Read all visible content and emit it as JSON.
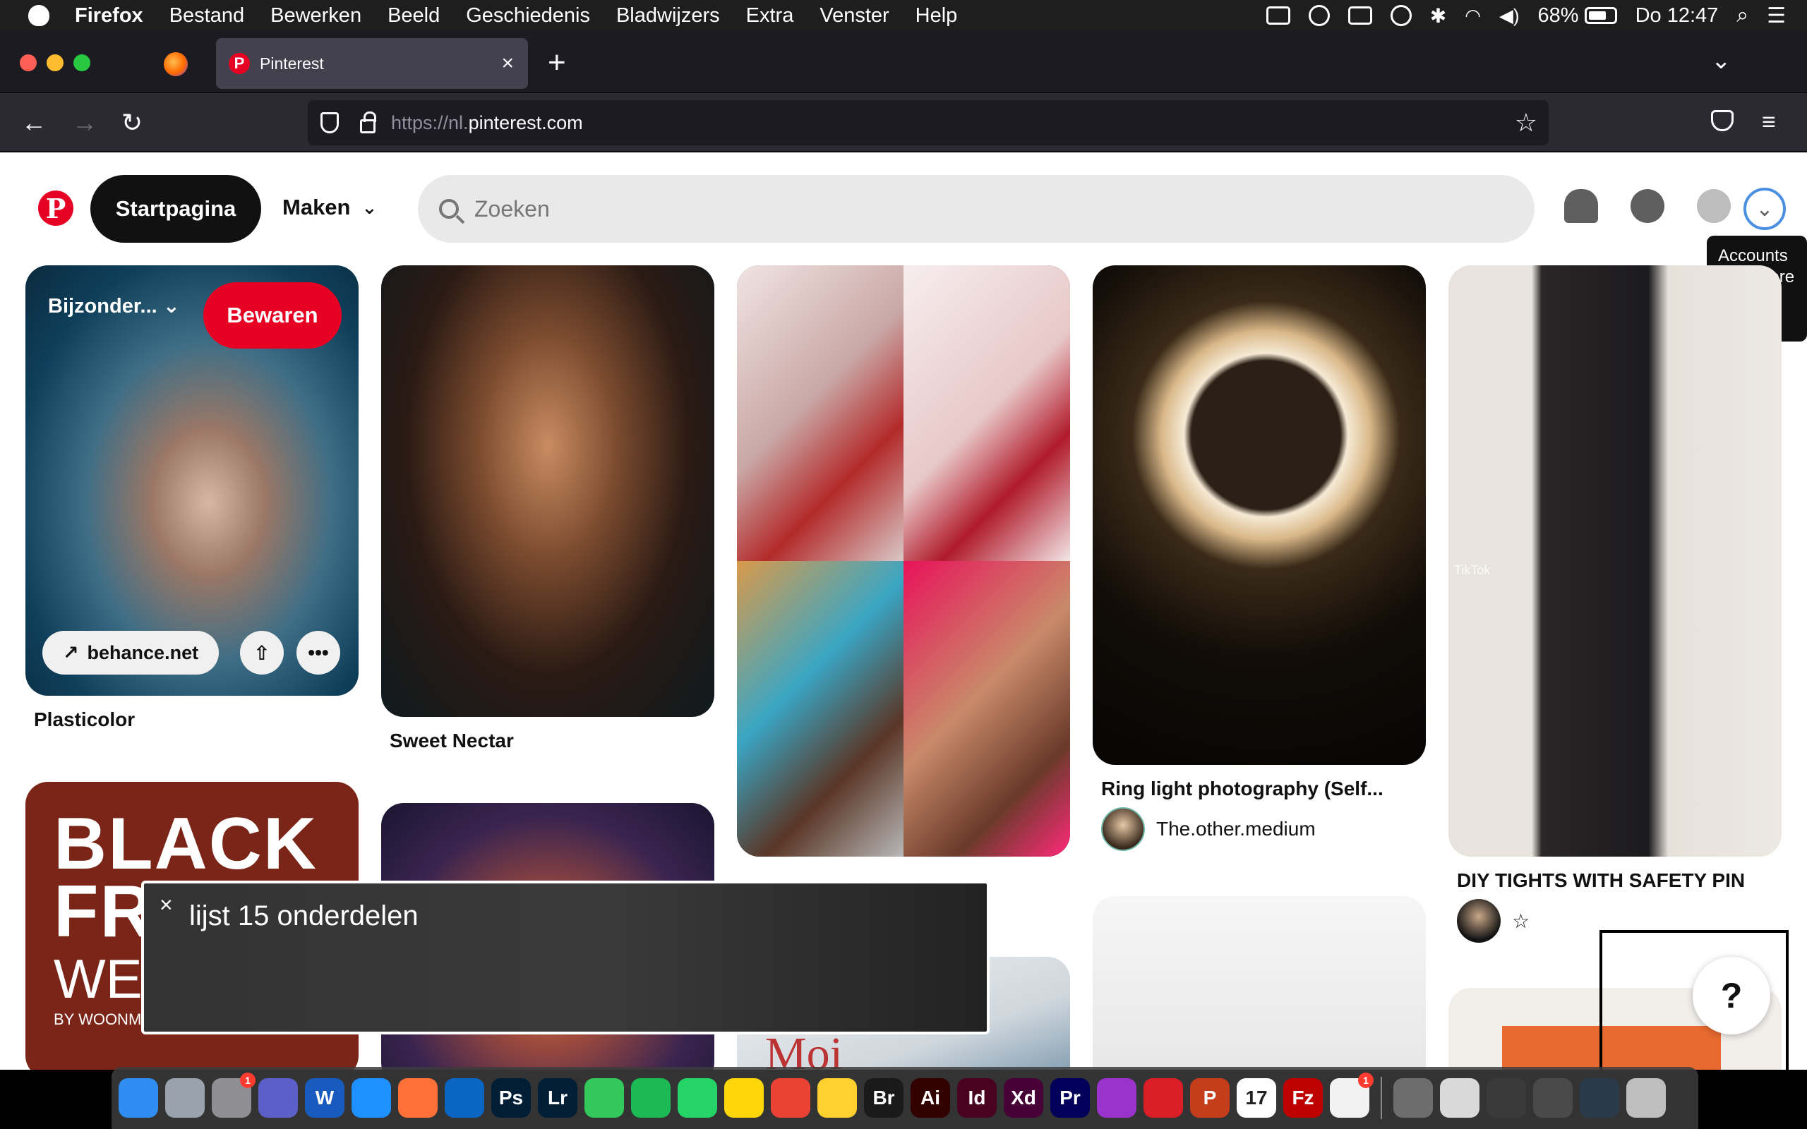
{
  "menubar": {
    "app_name": "Firefox",
    "items": [
      "Bestand",
      "Bewerken",
      "Beeld",
      "Geschiedenis",
      "Bladwijzers",
      "Extra",
      "Venster",
      "Help"
    ],
    "battery": "68%",
    "clock": "Do 12:47"
  },
  "browser": {
    "tab_title": "Pinterest",
    "tab_favicon": "P",
    "url_prefix": "https://nl.",
    "url_domain": "pinterest.com"
  },
  "pinterest": {
    "logo": "P",
    "home_label": "Startpagina",
    "create_label": "Maken",
    "search_placeholder": "Zoeken",
    "tooltip": "Accounts en andere opties",
    "pins": [
      {
        "board_select": "Bijzonder...",
        "save_label": "Bewaren",
        "link_label": "behance.net",
        "title": "Plasticolor"
      },
      {
        "title": "Sweet Nectar"
      },
      {
        "title": ""
      },
      {
        "title": "Ring light photography (Self...",
        "user": "The.other.medium"
      },
      {
        "title": "DIY TIGHTS WITH SAFETY PIN",
        "watermark": "TikTok"
      },
      {
        "image_text_1": "BLACK",
        "image_text_2": "FR",
        "image_text_3": "WE",
        "image_text_4": "BY WOONM"
      },
      {
        "title": ""
      },
      {
        "image_text": "Moi"
      },
      {
        "title": ""
      },
      {
        "title": ""
      }
    ],
    "help_label": "?"
  },
  "voiceover": {
    "caption": "lijst  15 onderdelen"
  },
  "dock": {
    "apps": [
      {
        "icon": "finder-icon",
        "color": "#2f8cf0",
        "label": ""
      },
      {
        "icon": "launchpad-icon",
        "color": "#9aa3ad",
        "label": ""
      },
      {
        "icon": "system-preferences-icon",
        "color": "#8e8e93",
        "label": "",
        "badge": "1"
      },
      {
        "icon": "teams-icon",
        "color": "#5b5fc7",
        "label": ""
      },
      {
        "icon": "word-icon",
        "color": "#185abd",
        "label": "W"
      },
      {
        "icon": "safari-icon",
        "color": "#1e90ff",
        "label": ""
      },
      {
        "icon": "firefox-icon",
        "color": "#ff7139",
        "label": ""
      },
      {
        "icon": "vscode-icon",
        "color": "#0a66c2",
        "label": ""
      },
      {
        "icon": "photoshop-icon",
        "color": "#001e36",
        "label": "Ps"
      },
      {
        "icon": "lightroom-icon",
        "color": "#001e36",
        "label": "Lr"
      },
      {
        "icon": "facetime-icon",
        "color": "#34c759",
        "label": ""
      },
      {
        "icon": "spotify-icon",
        "color": "#1db954",
        "label": ""
      },
      {
        "icon": "whatsapp-icon",
        "color": "#25d366",
        "label": ""
      },
      {
        "icon": "notes-icon",
        "color": "#ffd60a",
        "label": ""
      },
      {
        "icon": "chrome-icon",
        "color": "#ea4335",
        "label": ""
      },
      {
        "icon": "miro-icon",
        "color": "#ffd02f",
        "label": ""
      },
      {
        "icon": "bridge-icon",
        "color": "#1a1a1a",
        "label": "Br"
      },
      {
        "icon": "illustrator-icon",
        "color": "#330000",
        "label": "Ai"
      },
      {
        "icon": "indesign-icon",
        "color": "#49021f",
        "label": "Id"
      },
      {
        "icon": "xd-icon",
        "color": "#470137",
        "label": "Xd"
      },
      {
        "icon": "premiere-icon",
        "color": "#00005b",
        "label": "Pr"
      },
      {
        "icon": "podcasts-icon",
        "color": "#9933cc",
        "label": ""
      },
      {
        "icon": "creative-cloud-icon",
        "color": "#da1f26",
        "label": ""
      },
      {
        "icon": "powerpoint-icon",
        "color": "#c43e1c",
        "label": "P"
      },
      {
        "icon": "calendar-icon",
        "color": "#ffffff",
        "label": "17"
      },
      {
        "icon": "filezilla-icon",
        "color": "#bf0000",
        "label": "Fz"
      },
      {
        "icon": "reminders-icon",
        "color": "#f2f2f2",
        "label": "",
        "badge": "1"
      },
      {
        "icon": "voiceover-utility-icon",
        "color": "#6d6d6d",
        "label": ""
      },
      {
        "icon": "document-icon",
        "color": "#d9d9d9",
        "label": ""
      },
      {
        "icon": "window-thumb-icon",
        "color": "#3a3a3a",
        "label": ""
      },
      {
        "icon": "window-thumb-icon",
        "color": "#4a4a4a",
        "label": ""
      },
      {
        "icon": "window-thumb-icon",
        "color": "#2a3a4a",
        "label": ""
      },
      {
        "icon": "trash-icon",
        "color": "#bfbfbf",
        "label": ""
      }
    ]
  }
}
